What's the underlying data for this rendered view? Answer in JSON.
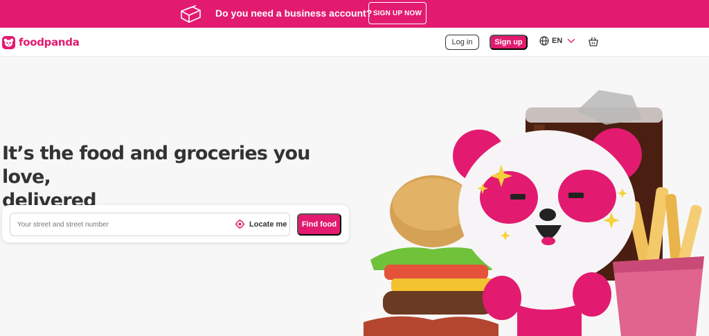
{
  "banner": {
    "icon": "business-bag-icon",
    "text": "Do you need a business account?",
    "button_label": "SIGN UP NOW"
  },
  "header": {
    "logo_icon": "panda-logo-icon",
    "brand": "foodpanda",
    "login_label": "Log in",
    "signup_label": "Sign up",
    "language": "EN",
    "language_icon": "globe-icon",
    "cart_icon": "shopping-basket-icon"
  },
  "hero": {
    "title_line1": "It’s the food and groceries you love,",
    "title_line2": "delivered",
    "search_placeholder": "Your street and street number",
    "locate_label": "Locate me",
    "find_label": "Find food",
    "illustration": "panda-mascot-with-burger-cola-fries"
  },
  "colors": {
    "brand": "#e21b70",
    "text": "#333333",
    "background": "#f7f7f7"
  }
}
